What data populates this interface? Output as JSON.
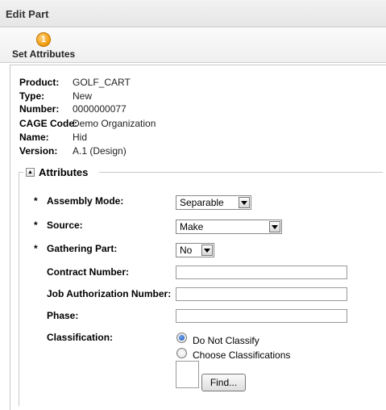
{
  "window": {
    "title": "Edit Part"
  },
  "wizard": {
    "step_number": "1",
    "step_label": "Set Attributes"
  },
  "info": [
    {
      "label": "Product:",
      "value": "GOLF_CART"
    },
    {
      "label": "Type:",
      "value": "New"
    },
    {
      "label": "Number:",
      "value": "0000000077"
    },
    {
      "label": "CAGE Code:",
      "value": "Demo Organization"
    },
    {
      "label": "Name:",
      "value": "Hid"
    },
    {
      "label": "Version:",
      "value": "A.1 (Design)"
    }
  ],
  "attributes": {
    "legend": "Attributes",
    "collapse_symbol": "▲",
    "required_marker": "*",
    "assembly_mode": {
      "label": "Assembly Mode:",
      "value": "Separable"
    },
    "source": {
      "label": "Source:",
      "value": "Make"
    },
    "gathering_part": {
      "label": "Gathering Part:",
      "value": "No"
    },
    "contract_number": {
      "label": "Contract Number:",
      "value": ""
    },
    "job_authorization_number": {
      "label": "Job Authorization Number:",
      "value": ""
    },
    "phase": {
      "label": "Phase:",
      "value": ""
    },
    "classification": {
      "label": "Classification:",
      "options": [
        "Do Not Classify",
        "Choose Classifications"
      ],
      "selected": "Do Not Classify"
    },
    "find_button": "Find..."
  }
}
